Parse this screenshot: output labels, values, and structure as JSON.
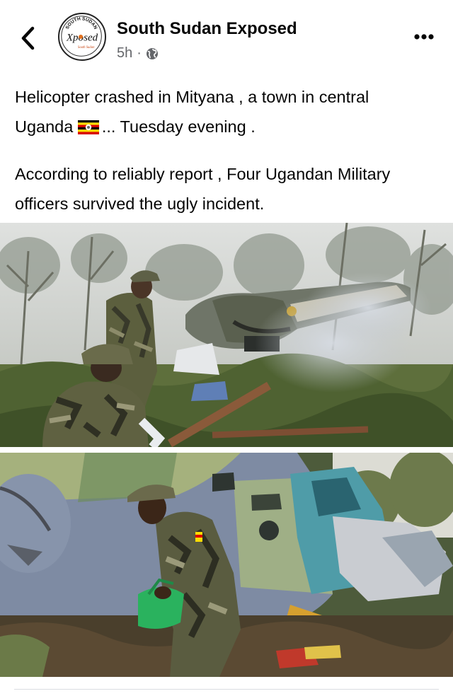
{
  "header": {
    "page_name": "South Sudan Exposed",
    "time": "5h",
    "separator": "·",
    "privacy_icon": "globe-icon",
    "back_icon": "chevron-left-icon",
    "more_icon": "more-horizontal-icon",
    "avatar": {
      "arc_text": "SOUTH SUDAN",
      "logo_text": "Xposed",
      "tagline": "South Sudan"
    }
  },
  "post": {
    "line1": "Helicopter crashed in Mityana , a town in central",
    "line2_before_flag": "Uganda ",
    "line2_after_flag": "... Tuesday evening .",
    "paragraph2": "According to reliably report , Four Ugandan Military officers survived the ugly incident.",
    "flag_icon": "uganda-flag-icon"
  },
  "photos": [
    {
      "subject": "soldiers beside crashed helicopter in misty forest"
    },
    {
      "subject": "soldier carrying green bag beside helicopter wreckage"
    }
  ],
  "colors": {
    "text": "#050505",
    "secondary_text": "#65676b",
    "divider": "#dadde1",
    "helicopter_blue": "#7d8ca8",
    "camo_green": "#5a5d3c"
  }
}
